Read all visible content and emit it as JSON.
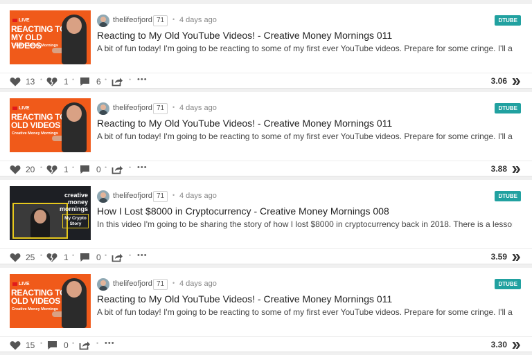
{
  "posts": [
    {
      "thumb": {
        "live": "LIVE",
        "big": "REACTING TO MY OLD VIDEOS",
        "small": "Creative Money Mornings"
      },
      "author": "thelifeofjord",
      "reputation": "71",
      "age": "4 days ago",
      "tag": "DTUBE",
      "title": "Reacting to My Old YouTube Videos! - Creative Money Mornings 011",
      "description": "A bit of fun today! I'm going to be reacting to some of my first ever YouTube videos. Prepare for some cringe. I'll a...",
      "upvotes": "13",
      "downvotes": "1",
      "comments": "6",
      "payout": "3.06"
    },
    {
      "thumb": {
        "live": "LIVE",
        "big": "REACTING TO OLD VIDEOS",
        "small": "Creative Money Mornings"
      },
      "author": "thelifeofjord",
      "reputation": "71",
      "age": "4 days ago",
      "tag": "DTUBE",
      "title": "Reacting to My Old YouTube Videos! - Creative Money Mornings 011",
      "description": "A bit of fun today! I'm going to be reacting to some of my first ever YouTube videos. Prepare for some cringe. I'll a...",
      "upvotes": "20",
      "downvotes": "1",
      "comments": "0",
      "payout": "3.88"
    },
    {
      "thumb": {
        "big": "creative money mornings",
        "small": "My Crypto Story"
      },
      "author": "thelifeofjord",
      "reputation": "71",
      "age": "4 days ago",
      "tag": "DTUBE",
      "title": "How I Lost $8000 in Cryptocurrency - Creative Money Mornings 008",
      "description": "In this video I'm going to be sharing the story of how I lost $8000 in cryptocurrency back in 2018. There is a lesson...",
      "upvotes": "25",
      "downvotes": "1",
      "comments": "0",
      "payout": "3.59"
    },
    {
      "thumb": {
        "live": "LIVE",
        "big": "REACTING TO OLD VIDEOS",
        "small": "Creative Money Mornings"
      },
      "author": "thelifeofjord",
      "reputation": "71",
      "age": "4 days ago",
      "tag": "DTUBE",
      "title": "Reacting to My Old YouTube Videos! - Creative Money Mornings 011",
      "description": "A bit of fun today! I'm going to be reacting to some of my first ever YouTube videos. Prepare for some cringe. I'll a...",
      "upvotes": "15",
      "comments": "0",
      "payout": "3.30"
    }
  ],
  "colors": {
    "tag": "#21a1a0",
    "thumb_orange": "#f05a1a",
    "icon": "#555555"
  }
}
